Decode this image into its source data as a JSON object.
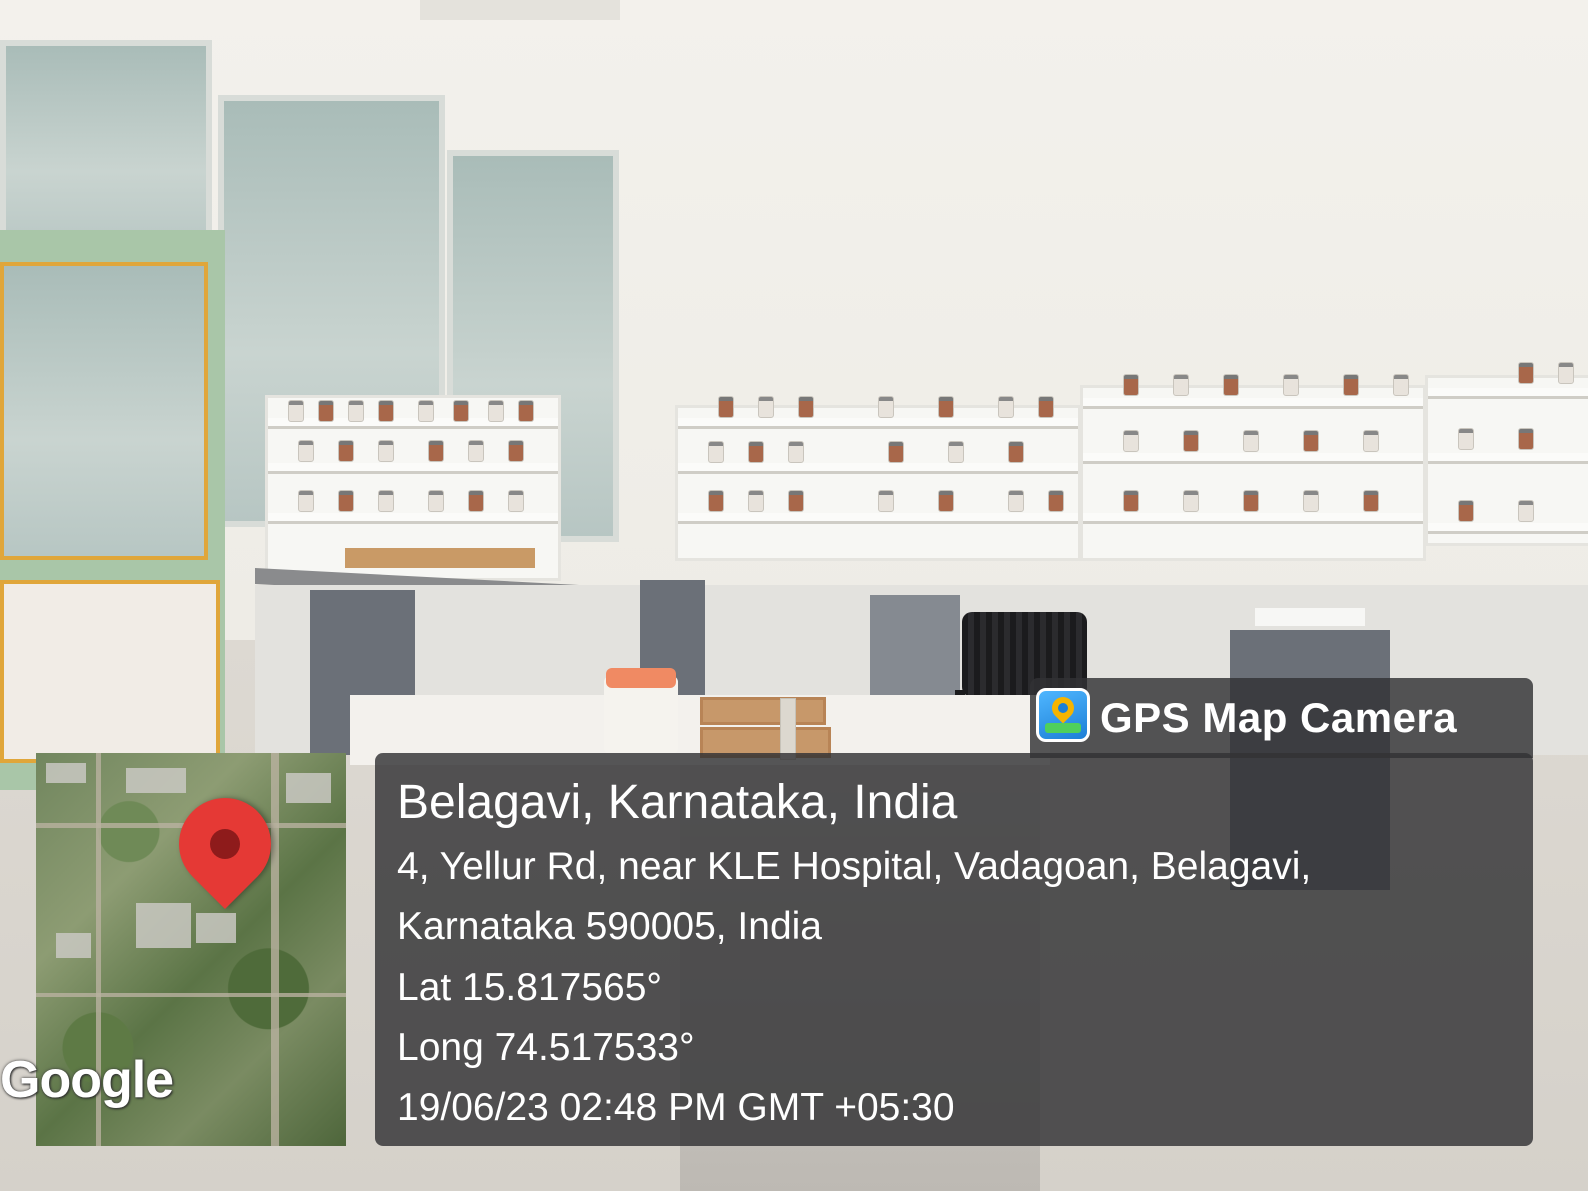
{
  "watermark": {
    "brand": "GPS Map Camera",
    "icon": "gps-map-camera-icon"
  },
  "map": {
    "provider_logo": "Google",
    "marker_icon": "location-pin-icon",
    "marker_color": "#e53935"
  },
  "location": {
    "title": "Belagavi, Karnataka, India",
    "address_line_1": "4, Yellur Rd, near KLE Hospital, Vadagoan, Belagavi,",
    "address_line_2": "Karnataka 590005, India",
    "latitude": "Lat 15.817565°",
    "longitude": "Long 74.517533°",
    "timestamp": "19/06/23 02:48 PM GMT +05:30"
  },
  "colors": {
    "overlay_bg": "rgba(50,50,52,0.82)",
    "text": "#ffffff"
  }
}
